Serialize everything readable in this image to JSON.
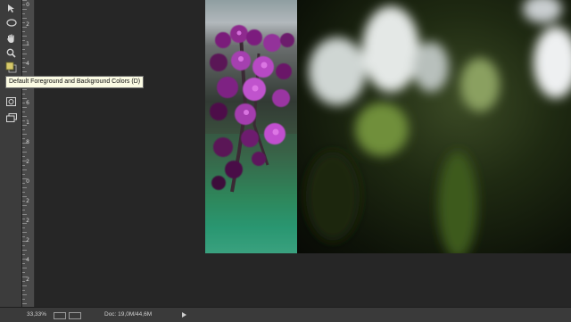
{
  "tooltip": {
    "text": "Default Foreground and Background Colors (D)"
  },
  "ruler": {
    "labels": [
      "0",
      "2",
      "1",
      "4",
      "1",
      "6",
      "1",
      "8",
      "2",
      "0",
      "2",
      "2",
      "2",
      "4",
      "2"
    ]
  },
  "status": {
    "zoom": "33,33%",
    "doc": "Doc: 19,0M/44,6M"
  },
  "icons": {
    "tools": [
      "move-icon",
      "ellipse-marquee-icon",
      "hand-icon",
      "zoom-icon",
      "color-swatch-icon",
      "quick-mask-icon",
      "screen-mode-icon"
    ]
  }
}
